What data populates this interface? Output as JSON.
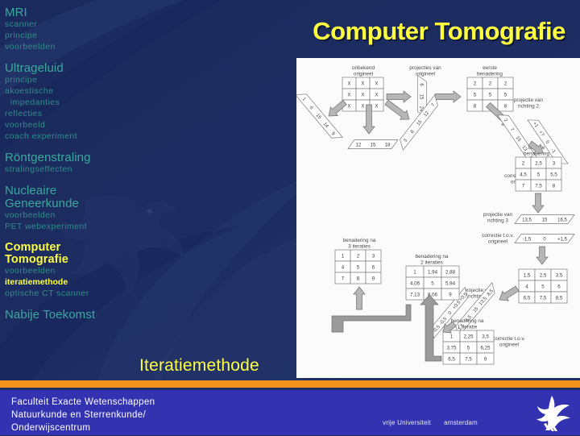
{
  "slide": {
    "title": "Computer Tomografie",
    "caption": "Iteratiemethode"
  },
  "sidebar": {
    "groups": [
      {
        "heading": "MRI",
        "active": false,
        "items": [
          {
            "label": "scanner",
            "active": false
          },
          {
            "label": "principe",
            "active": false
          },
          {
            "label": "voorbeelden",
            "active": false
          }
        ]
      },
      {
        "heading": "Ultrageluid",
        "active": false,
        "items": [
          {
            "label": "principe",
            "active": false
          },
          {
            "label": "akoestische",
            "active": false
          },
          {
            "label": "  impedanties",
            "active": false
          },
          {
            "label": "reflecties",
            "active": false
          },
          {
            "label": "voorbeeld",
            "active": false
          },
          {
            "label": "coach experiment",
            "active": false
          }
        ]
      },
      {
        "heading": "Röntgenstraling",
        "active": false,
        "items": [
          {
            "label": "stralingseffecten",
            "active": false
          }
        ]
      },
      {
        "heading": "Nucleaire\n  Geneerkunde",
        "active": false,
        "items": [
          {
            "label": "voorbeelden",
            "active": false
          },
          {
            "label": "PET webexperiment",
            "active": false
          }
        ]
      },
      {
        "heading": "Computer\n  Tomografie",
        "active": true,
        "items": [
          {
            "label": "voorbeelden",
            "active": false
          },
          {
            "label": "iteratiemethode",
            "active": true
          },
          {
            "label": "optische CT scanner",
            "active": false
          }
        ]
      },
      {
        "heading": "Nabije Toekomst",
        "active": false,
        "items": []
      }
    ]
  },
  "footer": {
    "lines": "Faculteit Exacte Wetenschappen\nNatuurkunde en Sterrenkunde/\nOnderwijscentrum",
    "wordmark_1": "vrije Universiteit",
    "wordmark_2": "amsterdam"
  },
  "figure": {
    "labels": {
      "unknown_original": "onbekend\norigineel",
      "projections_original": "projecties van\norigineel",
      "first_approx": "eerste\nbenadering",
      "projection_dir2": "projectie van\nrichting 2",
      "correction_1": "correctie t.o.v.\norigineel",
      "second_approx": "tweede\nbenadering",
      "projection_dir3": "projectie van\nrichting 3",
      "correction_2": "correctie t.o.v.\norigineel",
      "approx_3_iter": "benadering na\n3 iteraties",
      "approx_2_iter": "benadering na\n2 iteraties",
      "approx_1_iter": "benadering na\n1 iteratie",
      "projection_dir4": "projectie van\nrichting 4",
      "correction_3": "correctie t.o.v.\norigineel"
    },
    "grids": {
      "unknown_original": [
        [
          "X",
          "X",
          "X"
        ],
        [
          "X",
          "X",
          "X"
        ],
        [
          "X",
          "X",
          "X"
        ]
      ],
      "first_approx": [
        [
          "2",
          "2",
          "2"
        ],
        [
          "5",
          "5",
          "5"
        ],
        [
          "8",
          "8",
          "8"
        ]
      ],
      "second_approx": [
        [
          "2",
          "2,5",
          "3"
        ],
        [
          "4,5",
          "5",
          "5,5"
        ],
        [
          "7",
          "7,5",
          "8"
        ]
      ],
      "approx_3_iter": [
        [
          "1",
          "2",
          "3"
        ],
        [
          "4",
          "5",
          "6"
        ],
        [
          "7",
          "8",
          "9"
        ]
      ],
      "approx_2_iter": [
        [
          "1",
          "1,94",
          "2,88"
        ],
        [
          "4,06",
          "5",
          "5,94"
        ],
        [
          "7,13",
          "8,06",
          "9"
        ]
      ],
      "approx_1_iter": [
        [
          "1",
          "2,25",
          "3,5"
        ],
        [
          "3,75",
          "5",
          "6,25"
        ],
        [
          "6,5",
          "7,5",
          "9"
        ]
      ],
      "mid_grid": [
        [
          "1,5",
          "2,5",
          "3,5"
        ],
        [
          "4",
          "5",
          "6"
        ],
        [
          "6,5",
          "7,5",
          "8,5"
        ]
      ]
    },
    "vectors": {
      "proj_vertical_original": [
        "6",
        "15",
        "24"
      ],
      "proj_horizontal_original": [
        "12",
        "15",
        "18"
      ],
      "proj_diag_left": [
        "1",
        "6",
        "15",
        "14",
        "9"
      ],
      "proj_diag_right": [
        "3",
        "8",
        "15",
        "12",
        "7"
      ],
      "proj_dir2": [
        "2",
        "7",
        "15",
        "13",
        "8"
      ],
      "correction_dir2": [
        "+1",
        "+?",
        "0",
        "-1",
        "-1"
      ],
      "proj_dir3": [
        "13,5",
        "15",
        "16,5"
      ],
      "correction_dir3": [
        "-1,5",
        "0",
        "+1,5"
      ],
      "proj_dir4": [
        "1,5",
        "6,5",
        "15",
        "13,5",
        "8,5"
      ],
      "correction_dir4": [
        "-0,5",
        "-0,5",
        "0",
        "+0,5",
        "+0,5"
      ]
    }
  }
}
